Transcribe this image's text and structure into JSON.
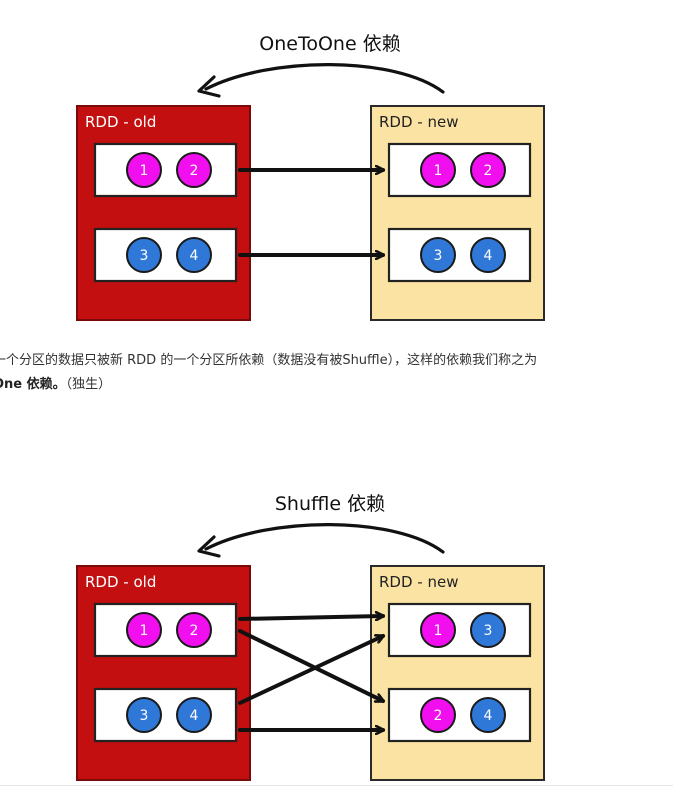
{
  "diagram1": {
    "title": "OneToOne 依赖",
    "old_label": "RDD - old",
    "new_label": "RDD - new",
    "old_partitions": [
      [
        "1",
        "2"
      ],
      [
        "3",
        "4"
      ]
    ],
    "new_partitions": [
      [
        "1",
        "2"
      ],
      [
        "3",
        "4"
      ]
    ],
    "links": [
      [
        0,
        0
      ],
      [
        1,
        1
      ]
    ]
  },
  "paragraph": {
    "line1": "一个分区的数据只被新 RDD 的一个分区所依赖（数据没有被Shuffle），这样的依赖我们称之为",
    "line2_bold": "One 依赖。",
    "line2_rest": "（独生）"
  },
  "diagram2": {
    "title": "Shuffle 依赖",
    "old_label": "RDD - old",
    "new_label": "RDD - new",
    "old_partitions": [
      [
        "1",
        "2"
      ],
      [
        "3",
        "4"
      ]
    ],
    "new_partitions": [
      [
        "1",
        "3"
      ],
      [
        "2",
        "4"
      ]
    ],
    "links": [
      [
        0,
        0
      ],
      [
        0,
        1
      ],
      [
        1,
        0
      ],
      [
        1,
        1
      ]
    ]
  },
  "colors": {
    "old_fill": "#c30f0f",
    "new_fill": "#fbe4a3",
    "magenta": "#f10ff0",
    "blue": "#2f78d8",
    "arrow": "#111111"
  }
}
